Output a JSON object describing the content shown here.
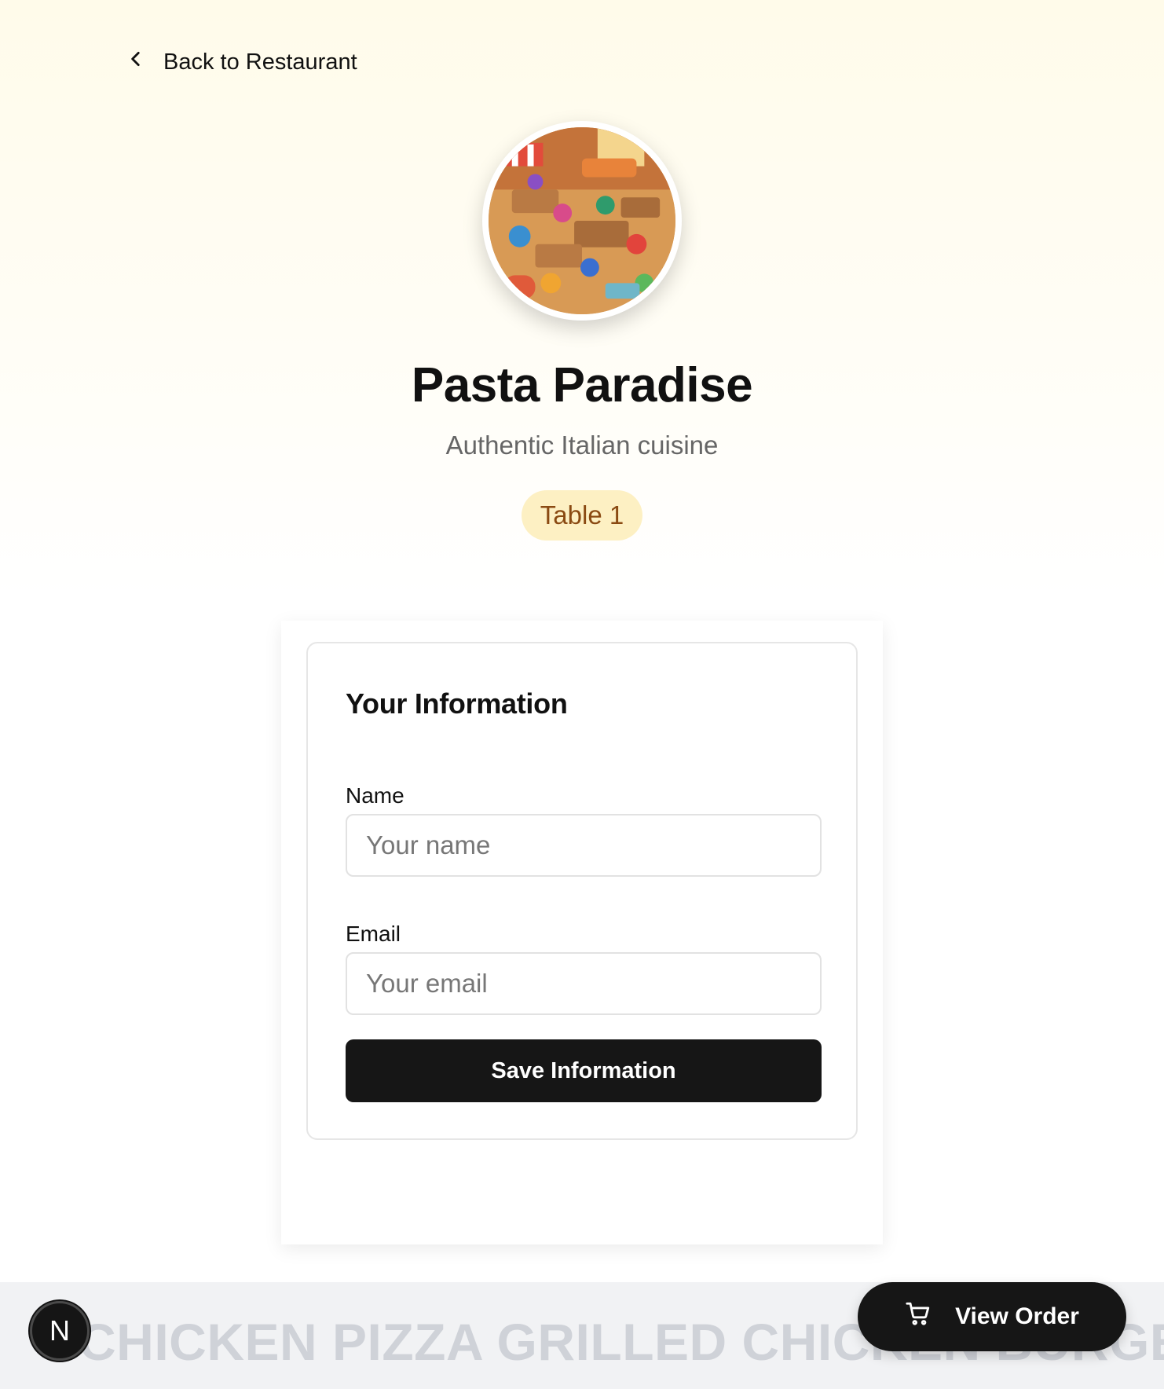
{
  "nav": {
    "back_label": "Back to Restaurant"
  },
  "restaurant": {
    "name": "Pasta Paradise",
    "description": "Authentic Italian cuisine",
    "table_badge": "Table 1"
  },
  "form": {
    "title": "Your Information",
    "name_label": "Name",
    "name_placeholder": "Your name",
    "name_value": "",
    "email_label": "Email",
    "email_placeholder": "Your email",
    "email_value": "",
    "save_label": "Save Information"
  },
  "ticker": {
    "text": "CHICKEN PIZZA GRILLED CHICKEN BURGER MAC"
  },
  "floating": {
    "dev_badge": "N",
    "view_order_label": "View Order"
  },
  "colors": {
    "accent_dark": "#161616",
    "badge_bg": "#fdf0c3",
    "badge_text": "#8a4a12",
    "header_bg": "#fffbea"
  },
  "icons": {
    "back": "chevron-left-icon",
    "cart": "cart-icon"
  }
}
